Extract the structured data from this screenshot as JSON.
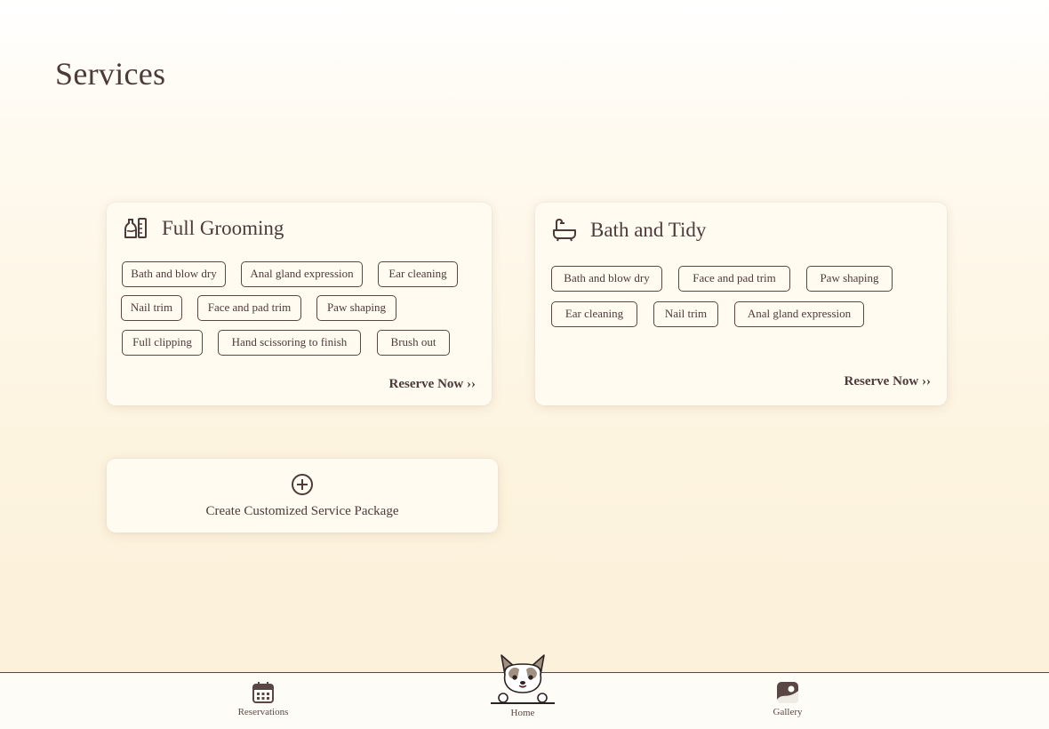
{
  "page": {
    "title": "Services"
  },
  "cards": [
    {
      "title": "Full Grooming",
      "icon": "grooming-bottles-icon",
      "tags": [
        "Bath and blow dry",
        "Anal gland expression",
        "Ear cleaning",
        "Nail trim",
        "Face and pad trim",
        "Paw shaping",
        "Full clipping",
        "Hand scissoring to finish",
        "Brush out"
      ],
      "reserve_label": "Reserve Now ››"
    },
    {
      "title": "Bath and Tidy",
      "icon": "bathtub-icon",
      "tags": [
        "Bath and blow dry",
        "Face and pad trim",
        "Paw shaping",
        "Ear cleaning",
        "Nail trim",
        "Anal gland expression"
      ],
      "reserve_label": "Reserve Now ››"
    }
  ],
  "create_package": {
    "label": "Create Customized Service Package",
    "icon": "plus-circle-icon"
  },
  "nav": {
    "items": [
      {
        "label": "Reservations",
        "icon": "calendar-icon"
      },
      {
        "label": "Home",
        "icon": "corgi-icon"
      },
      {
        "label": "Gallery",
        "icon": "image-icon"
      }
    ]
  },
  "colors": {
    "text": "#4d3a3a",
    "card_bg": "#fffbf1",
    "page_bg": "#fdf4e0",
    "border": "#5a4644"
  }
}
